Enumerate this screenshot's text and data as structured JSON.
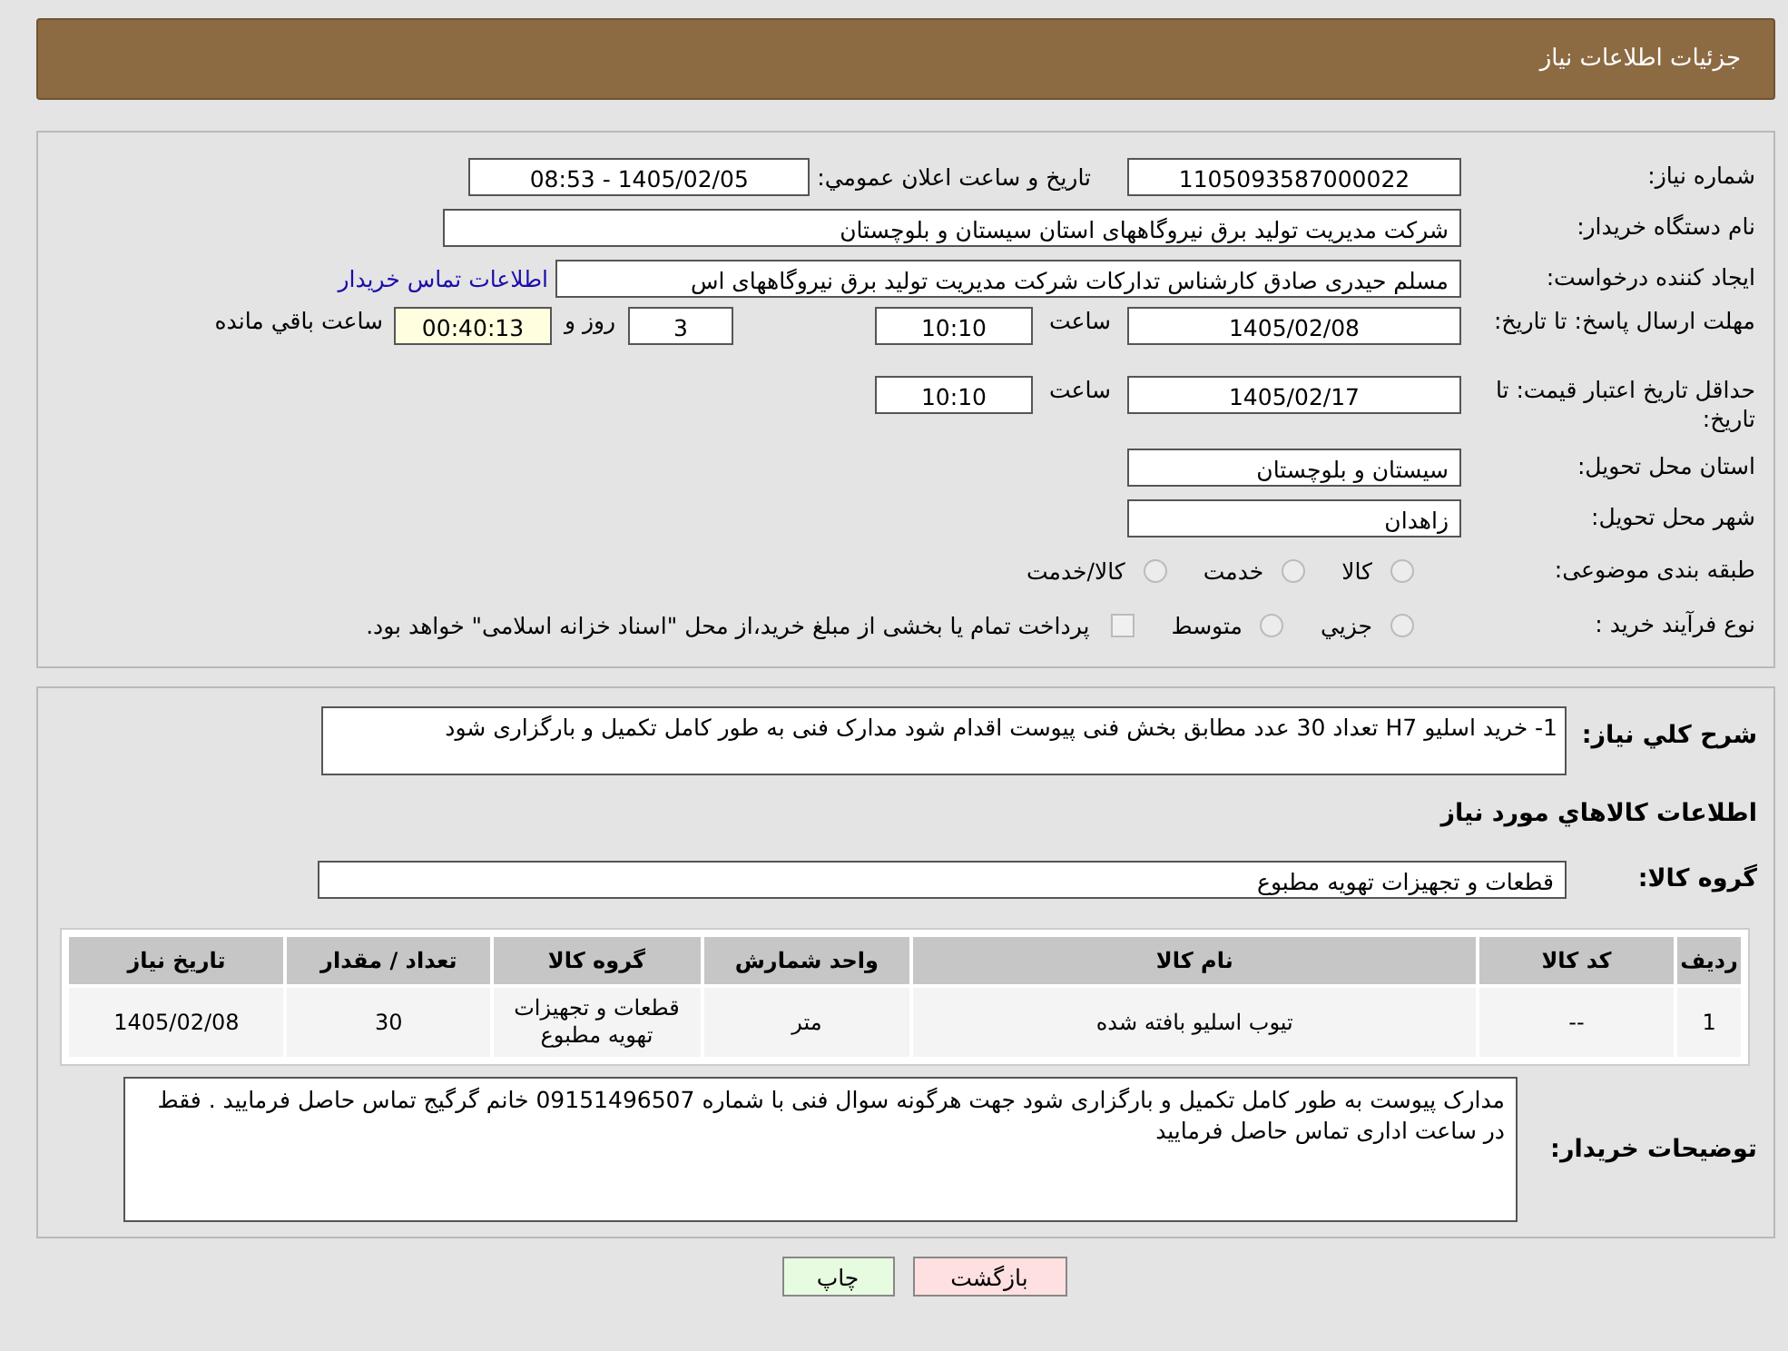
{
  "header": {
    "title": "جزئیات اطلاعات نیاز"
  },
  "details": {
    "need_number": {
      "label": "شماره نیاز:",
      "value": "1105093587000022"
    },
    "announce": {
      "label": "تاریخ و ساعت اعلان عمومي:",
      "value": "1405/02/05 - 08:53"
    },
    "buyer": {
      "label": "نام دستگاه خریدار:",
      "value": "شرکت مدیریت تولید برق نیروگاههای استان سیستان و بلوچستان"
    },
    "creator": {
      "label": "ایجاد کننده درخواست:",
      "value": "مسلم حیدری صادق کارشناس تدارکات شرکت مدیریت تولید برق نیروگاههای اس",
      "link": "اطلاعات تماس خریدار"
    },
    "deadline": {
      "label": "مهلت ارسال پاسخ: تا تاریخ:",
      "date": "1405/02/08",
      "time_label": "ساعت",
      "time": "10:10",
      "days": "3",
      "days_label": "روز و",
      "remaining": "00:40:13",
      "remaining_label": "ساعت باقي مانده"
    },
    "validity": {
      "label": "حداقل تاریخ اعتبار قیمت: تا تاریخ:",
      "date": "1405/02/17",
      "time_label": "ساعت",
      "time": "10:10"
    },
    "province": {
      "label": "استان محل تحویل:",
      "value": "سیستان و بلوچستان"
    },
    "city": {
      "label": "شهر محل تحویل:",
      "value": "زاهدان"
    },
    "category": {
      "label": "طبقه بندی موضوعی:",
      "options": [
        {
          "label": "کالا",
          "selected": false
        },
        {
          "label": "خدمت",
          "selected": false
        },
        {
          "label": "کالا/خدمت",
          "selected": false
        }
      ]
    },
    "process": {
      "label": "نوع فرآیند خرید :",
      "options": [
        {
          "label": "جزيي",
          "selected": false
        },
        {
          "label": "متوسط",
          "selected": false
        }
      ],
      "payment": {
        "label": "پرداخت تمام یا بخشی از مبلغ خرید،از محل \"اسناد خزانه اسلامی\" خواهد بود.",
        "checked": false
      }
    }
  },
  "goods": {
    "description": {
      "label": "شرح كلي نياز:",
      "value": "1- خرید اسلیو  H7  تعداد  30 عدد  مطابق بخش فنی پیوست اقدام شود مدارک فنی به طور کامل تکمیل و بارگزاری شود"
    },
    "heading": "اطلاعات كالاهاي مورد نياز",
    "group": {
      "label": "گروه کالا:",
      "value": "قطعات و تجهیزات تهویه مطبوع"
    },
    "table": {
      "columns": [
        "ردیف",
        "کد کالا",
        "نام کالا",
        "واحد شمارش",
        "گروه کالا",
        "تعداد / مقدار",
        "تاریخ نیاز"
      ],
      "rows": [
        [
          "1",
          "--",
          "تیوب اسلیو بافته شده",
          "متر",
          "قطعات و تجهیزات تهویه مطبوع",
          "30",
          "1405/02/08"
        ]
      ]
    },
    "notes": {
      "label": "توضیحات خریدار:",
      "value": "مدارک پیوست به طور کامل تکمیل و بارگزاری شود جهت هرگونه سوال فنی با شماره 09151496507 خانم گرگیج تماس حاصل فرمایید . فقط در ساعت اداری تماس حاصل فرمایید"
    }
  },
  "buttons": [
    {
      "kind": "back",
      "label": "بازگشت"
    },
    {
      "kind": "print",
      "label": "چاپ"
    }
  ]
}
